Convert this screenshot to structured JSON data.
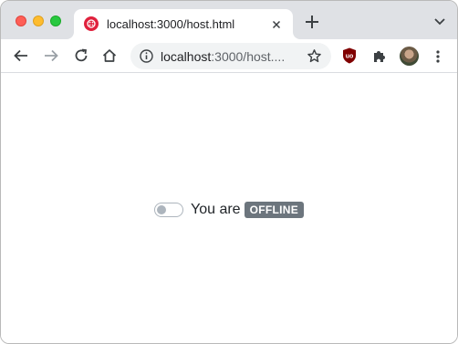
{
  "tab": {
    "title": "localhost:3000/host.html"
  },
  "addressbar": {
    "host": "localhost",
    "rest": ":3000/host...."
  },
  "icons": {
    "favicon": "twilio-icon",
    "back": "back-arrow-icon",
    "forward": "forward-arrow-icon",
    "reload": "reload-icon",
    "home": "home-icon",
    "info": "info-icon",
    "star": "bookmark-star-icon",
    "ublock": "ublock-origin-icon",
    "extensions": "puzzle-icon",
    "menu": "kebab-menu-icon"
  },
  "status": {
    "label": "You are",
    "badge": "OFFLINE",
    "online": false
  },
  "colors": {
    "badge": "#6c757d",
    "favicon": "#e0213d",
    "ublock": "#800000"
  }
}
